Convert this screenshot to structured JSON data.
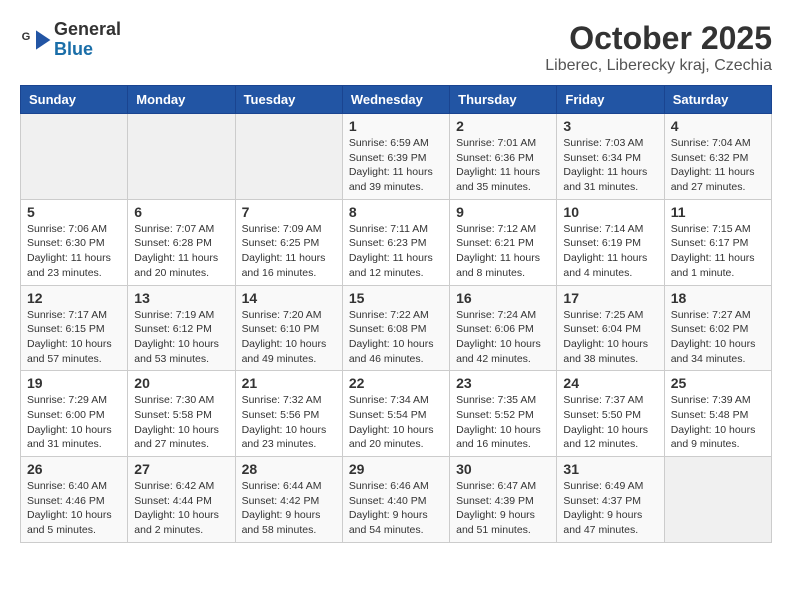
{
  "logo": {
    "general": "General",
    "blue": "Blue"
  },
  "title": "October 2025",
  "subtitle": "Liberec, Liberecky kraj, Czechia",
  "headers": [
    "Sunday",
    "Monday",
    "Tuesday",
    "Wednesday",
    "Thursday",
    "Friday",
    "Saturday"
  ],
  "weeks": [
    [
      {
        "day": "",
        "info": ""
      },
      {
        "day": "",
        "info": ""
      },
      {
        "day": "",
        "info": ""
      },
      {
        "day": "1",
        "info": "Sunrise: 6:59 AM\nSunset: 6:39 PM\nDaylight: 11 hours\nand 39 minutes."
      },
      {
        "day": "2",
        "info": "Sunrise: 7:01 AM\nSunset: 6:36 PM\nDaylight: 11 hours\nand 35 minutes."
      },
      {
        "day": "3",
        "info": "Sunrise: 7:03 AM\nSunset: 6:34 PM\nDaylight: 11 hours\nand 31 minutes."
      },
      {
        "day": "4",
        "info": "Sunrise: 7:04 AM\nSunset: 6:32 PM\nDaylight: 11 hours\nand 27 minutes."
      }
    ],
    [
      {
        "day": "5",
        "info": "Sunrise: 7:06 AM\nSunset: 6:30 PM\nDaylight: 11 hours\nand 23 minutes."
      },
      {
        "day": "6",
        "info": "Sunrise: 7:07 AM\nSunset: 6:28 PM\nDaylight: 11 hours\nand 20 minutes."
      },
      {
        "day": "7",
        "info": "Sunrise: 7:09 AM\nSunset: 6:25 PM\nDaylight: 11 hours\nand 16 minutes."
      },
      {
        "day": "8",
        "info": "Sunrise: 7:11 AM\nSunset: 6:23 PM\nDaylight: 11 hours\nand 12 minutes."
      },
      {
        "day": "9",
        "info": "Sunrise: 7:12 AM\nSunset: 6:21 PM\nDaylight: 11 hours\nand 8 minutes."
      },
      {
        "day": "10",
        "info": "Sunrise: 7:14 AM\nSunset: 6:19 PM\nDaylight: 11 hours\nand 4 minutes."
      },
      {
        "day": "11",
        "info": "Sunrise: 7:15 AM\nSunset: 6:17 PM\nDaylight: 11 hours\nand 1 minute."
      }
    ],
    [
      {
        "day": "12",
        "info": "Sunrise: 7:17 AM\nSunset: 6:15 PM\nDaylight: 10 hours\nand 57 minutes."
      },
      {
        "day": "13",
        "info": "Sunrise: 7:19 AM\nSunset: 6:12 PM\nDaylight: 10 hours\nand 53 minutes."
      },
      {
        "day": "14",
        "info": "Sunrise: 7:20 AM\nSunset: 6:10 PM\nDaylight: 10 hours\nand 49 minutes."
      },
      {
        "day": "15",
        "info": "Sunrise: 7:22 AM\nSunset: 6:08 PM\nDaylight: 10 hours\nand 46 minutes."
      },
      {
        "day": "16",
        "info": "Sunrise: 7:24 AM\nSunset: 6:06 PM\nDaylight: 10 hours\nand 42 minutes."
      },
      {
        "day": "17",
        "info": "Sunrise: 7:25 AM\nSunset: 6:04 PM\nDaylight: 10 hours\nand 38 minutes."
      },
      {
        "day": "18",
        "info": "Sunrise: 7:27 AM\nSunset: 6:02 PM\nDaylight: 10 hours\nand 34 minutes."
      }
    ],
    [
      {
        "day": "19",
        "info": "Sunrise: 7:29 AM\nSunset: 6:00 PM\nDaylight: 10 hours\nand 31 minutes."
      },
      {
        "day": "20",
        "info": "Sunrise: 7:30 AM\nSunset: 5:58 PM\nDaylight: 10 hours\nand 27 minutes."
      },
      {
        "day": "21",
        "info": "Sunrise: 7:32 AM\nSunset: 5:56 PM\nDaylight: 10 hours\nand 23 minutes."
      },
      {
        "day": "22",
        "info": "Sunrise: 7:34 AM\nSunset: 5:54 PM\nDaylight: 10 hours\nand 20 minutes."
      },
      {
        "day": "23",
        "info": "Sunrise: 7:35 AM\nSunset: 5:52 PM\nDaylight: 10 hours\nand 16 minutes."
      },
      {
        "day": "24",
        "info": "Sunrise: 7:37 AM\nSunset: 5:50 PM\nDaylight: 10 hours\nand 12 minutes."
      },
      {
        "day": "25",
        "info": "Sunrise: 7:39 AM\nSunset: 5:48 PM\nDaylight: 10 hours\nand 9 minutes."
      }
    ],
    [
      {
        "day": "26",
        "info": "Sunrise: 6:40 AM\nSunset: 4:46 PM\nDaylight: 10 hours\nand 5 minutes."
      },
      {
        "day": "27",
        "info": "Sunrise: 6:42 AM\nSunset: 4:44 PM\nDaylight: 10 hours\nand 2 minutes."
      },
      {
        "day": "28",
        "info": "Sunrise: 6:44 AM\nSunset: 4:42 PM\nDaylight: 9 hours\nand 58 minutes."
      },
      {
        "day": "29",
        "info": "Sunrise: 6:46 AM\nSunset: 4:40 PM\nDaylight: 9 hours\nand 54 minutes."
      },
      {
        "day": "30",
        "info": "Sunrise: 6:47 AM\nSunset: 4:39 PM\nDaylight: 9 hours\nand 51 minutes."
      },
      {
        "day": "31",
        "info": "Sunrise: 6:49 AM\nSunset: 4:37 PM\nDaylight: 9 hours\nand 47 minutes."
      },
      {
        "day": "",
        "info": ""
      }
    ]
  ]
}
